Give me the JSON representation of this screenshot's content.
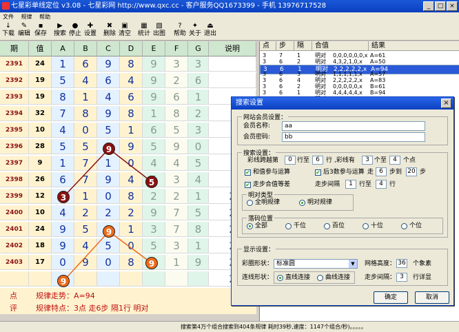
{
  "window": {
    "title": "七星彩单线定位 v3.08 - 七星彩网 http://www.qxc.cc - 客户服务QQ1673399 - 手机 13976717528",
    "minimize": "_",
    "maximize": "□",
    "close": "×"
  },
  "menu": [
    "文件",
    "规律",
    "帮助"
  ],
  "toolbar": [
    {
      "label": "下载",
      "icon": "↓"
    },
    {
      "label": "编辑",
      "icon": "✎"
    },
    {
      "label": "保存",
      "icon": "▪"
    },
    {
      "label": "搜索",
      "icon": "▶"
    },
    {
      "label": "停止",
      "icon": "●"
    },
    {
      "label": "设置",
      "icon": "✚"
    },
    {
      "label": "删除",
      "icon": "✖"
    },
    {
      "label": "清空",
      "icon": "▣"
    },
    {
      "label": "统计",
      "icon": "▦"
    },
    {
      "label": "出图",
      "icon": "▧"
    },
    {
      "label": "帮助",
      "icon": "?"
    },
    {
      "label": "关于",
      "icon": "✦"
    },
    {
      "label": "退出",
      "icon": "⏏"
    }
  ],
  "grid": {
    "headers": [
      "期",
      "值",
      "A",
      "B",
      "C",
      "D",
      "E",
      "F",
      "G",
      "说明"
    ],
    "rows": [
      {
        "period": "2391",
        "val": "24",
        "d": [
          "1",
          "6",
          "9",
          "8",
          "9",
          "3",
          "3"
        ],
        "note": ""
      },
      {
        "period": "2392",
        "val": "19",
        "d": [
          "5",
          "4",
          "6",
          "4",
          "9",
          "2",
          "6"
        ],
        "note": ""
      },
      {
        "period": "2393",
        "val": "19",
        "d": [
          "8",
          "1",
          "4",
          "6",
          "9",
          "6",
          "1"
        ],
        "note": ""
      },
      {
        "period": "2394",
        "val": "32",
        "d": [
          "7",
          "8",
          "9",
          "8",
          "1",
          "8",
          "2"
        ],
        "note": ""
      },
      {
        "period": "2395",
        "val": "10",
        "d": [
          "4",
          "0",
          "5",
          "1",
          "6",
          "5",
          "3"
        ],
        "note": ""
      },
      {
        "period": "2396",
        "val": "28",
        "d": [
          "5",
          "5",
          "9",
          "9",
          "5",
          "9",
          "0"
        ],
        "note": ""
      },
      {
        "period": "2397",
        "val": "9",
        "d": [
          "1",
          "7",
          "1",
          "0",
          "4",
          "4",
          "5"
        ],
        "note": ""
      },
      {
        "period": "2398",
        "val": "26",
        "d": [
          "6",
          "7",
          "9",
          "4",
          "5",
          "3",
          "4"
        ],
        "note": ""
      },
      {
        "period": "2399",
        "val": "12",
        "d": [
          "3",
          "1",
          "0",
          "8",
          "2",
          "2",
          "1"
        ],
        "note": "2"
      },
      {
        "period": "2400",
        "val": "10",
        "d": [
          "4",
          "2",
          "2",
          "2",
          "9",
          "7",
          "5"
        ],
        "note": "2"
      },
      {
        "period": "2401",
        "val": "24",
        "d": [
          "9",
          "5",
          "9",
          "1",
          "3",
          "7",
          "8"
        ],
        "note": "2"
      },
      {
        "period": "2402",
        "val": "18",
        "d": [
          "9",
          "4",
          "5",
          "0",
          "5",
          "3",
          "1"
        ],
        "note": "2"
      },
      {
        "period": "2403",
        "val": "17",
        "d": [
          "0",
          "9",
          "0",
          "8",
          "9",
          "1",
          "9"
        ],
        "note": "2"
      },
      {
        "period": "",
        "val": "",
        "d": [
          "",
          "",
          "",
          "",
          "",
          "",
          ""
        ],
        "note": "2"
      }
    ],
    "circles_dark": [
      "9",
      "5",
      "3"
    ],
    "circles_orange": [
      "9",
      "9",
      "9"
    ],
    "pattern_trend_label": "点",
    "pattern_trend": "规律走势：A=94",
    "pattern_feat_label": "评",
    "pattern_feat": "规律特点：3点 走6步 隔1行 明对"
  },
  "results": {
    "headers": [
      "点",
      "步",
      "隔",
      "合值",
      "结果"
    ],
    "rows": [
      {
        "pt": "3",
        "step": "7",
        "gap": "1",
        "type": "明对",
        "sum": "0,0,0,0,0,0,x",
        "res": "A=61",
        "sel": false
      },
      {
        "pt": "3",
        "step": "6",
        "gap": "2",
        "type": "明对",
        "sum": "4,3,2,1,0,x",
        "res": "A=50",
        "sel": false
      },
      {
        "pt": "3",
        "step": "6",
        "gap": "1",
        "type": "明对",
        "sum": "2,2,2,2,2,x",
        "res": "A=94",
        "sel": true
      },
      {
        "pt": "3",
        "step": "6",
        "gap": "3",
        "type": "明对",
        "sum": "1,1,1,1,1,x",
        "res": "A=57",
        "sel": false
      },
      {
        "pt": "3",
        "step": "6",
        "gap": "4",
        "type": "明对",
        "sum": "2,2,2,2,2,x",
        "res": "A=83",
        "sel": false
      },
      {
        "pt": "3",
        "step": "6",
        "gap": "2",
        "type": "明对",
        "sum": "0,0,0,0,0,x",
        "res": "B=61",
        "sel": false
      },
      {
        "pt": "3",
        "step": "6",
        "gap": "1",
        "type": "明对",
        "sum": "4,4,4,4,4,x",
        "res": "B=94",
        "sel": false
      },
      {
        "pt": "3",
        "step": "6",
        "gap": "1",
        "type": "明对",
        "sum": "3,3,3,3,3,x",
        "res": "A=94",
        "sel": false
      },
      {
        "pt": "3",
        "step": "6",
        "gap": "1",
        "type": "明对",
        "sum": "5,5,5,5,5,x",
        "res": "B=94",
        "sel": false
      }
    ]
  },
  "status": "搜索第4万个组合搜索到404条规律 耗时39秒,速度：1147个组合/秒)。。。。。",
  "dialog": {
    "title": "搜索设置",
    "close": "×",
    "member": {
      "caption": "网站会员设置：",
      "name_label": "会员名称:",
      "name_value": "aa",
      "pwd_label": "会员密码:",
      "pwd_value": "bb"
    },
    "search": {
      "caption": "搜索设置：",
      "color_cross": "彩线跨越第",
      "row_from": "0",
      "row_to_label": "行至",
      "row_to": "6",
      "row_unit": "行",
      "color_has": ",彩线有",
      "pt_from": "3",
      "pt_to_label": "个至",
      "pt_to": "4",
      "pt_unit": "个点",
      "c1": "和值参与运算",
      "c2": "后3数参与运算",
      "walk_label": "走",
      "walk_from": "6",
      "walk_to_label": "步到",
      "walk_to": "20",
      "walk_unit": "步",
      "c3": "走步合值等差",
      "interval_label": "走步间隔",
      "int_from": "1",
      "int_to_label": "行至",
      "int_to": "4",
      "int_unit": "行",
      "mingdui_caption": "明对类型",
      "mingdui_all": "全明规律",
      "mingdui_pair": "明对规律",
      "pos_caption": "落码位置",
      "pos_all": "全部",
      "pos_thousand": "千位",
      "pos_hundred": "百位",
      "pos_ten": "十位",
      "pos_unit": "个位"
    },
    "display": {
      "caption": "显示设置：",
      "shape_label": "彩圈形状：",
      "shape_value": "标准圆",
      "height_label": "网格高度：",
      "height_value": "36",
      "height_unit": "个象素",
      "line_label": "连线形状：",
      "line_straight": "直线连接",
      "line_curve": "曲线连接",
      "step_label": "走步间隔：",
      "step_value": "3",
      "step_unit": "行详显"
    },
    "ok": "确定",
    "cancel": "取消"
  }
}
